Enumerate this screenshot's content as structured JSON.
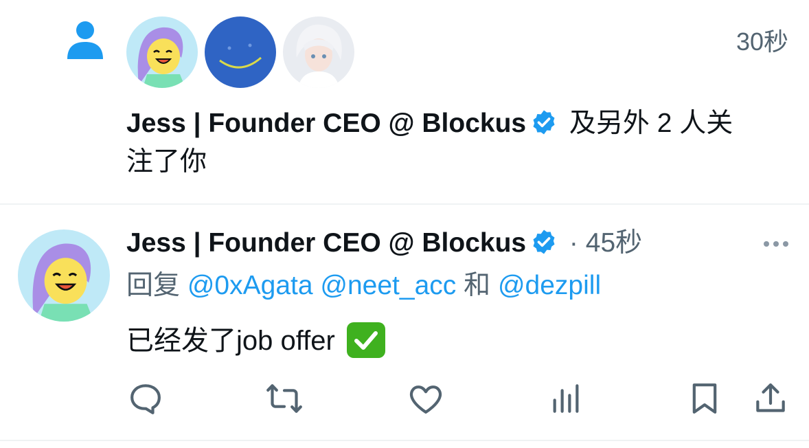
{
  "notification": {
    "type_icon": "person-icon",
    "time": "30秒",
    "name": "Jess | Founder CEO @ Blockus",
    "text_line1": " 及另外 2 人关",
    "text_line2": "注了你",
    "avatars": [
      "cartoon-girl-avatar",
      "blue-smiley-avatar",
      "anime-boy-avatar"
    ]
  },
  "tweet": {
    "name": "Jess | Founder CEO @ Blockus",
    "separator": " · ",
    "time": "45秒",
    "reply_prefix": "回复 ",
    "mentions": [
      "@0xAgata",
      "@neet_acc",
      "@dezpill"
    ],
    "reply_conjunction": " 和 ",
    "text": "已经发了job offer ",
    "emoji": "check-mark-emoji"
  },
  "actions": [
    "reply-icon",
    "retweet-icon",
    "like-icon",
    "views-icon",
    "bookmark-icon",
    "share-icon"
  ],
  "colors": {
    "accent": "#1d9bf0",
    "muted": "#536471",
    "divider": "#eff3f4"
  }
}
